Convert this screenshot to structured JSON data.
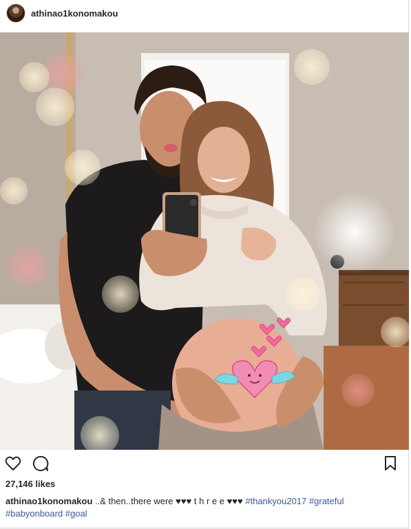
{
  "post": {
    "username": "athinao1konomakou",
    "likes_text": "27,146 likes",
    "caption": {
      "username": "athinao1konomakou",
      "text": "..& then..there were ♥♥♥ t h r e e ♥♥♥",
      "hashtags": [
        "#thankyou2017",
        "#grateful",
        "#babyonboard",
        "#goal"
      ]
    }
  },
  "icons": {
    "like": "heart-outline-icon",
    "comment": "speech-bubble-icon",
    "save": "bookmark-icon"
  },
  "colors": {
    "hashtag": "#385898",
    "text": "#262626",
    "belly_doodle": "#f06a9e",
    "wings": "#7fd6e0"
  }
}
